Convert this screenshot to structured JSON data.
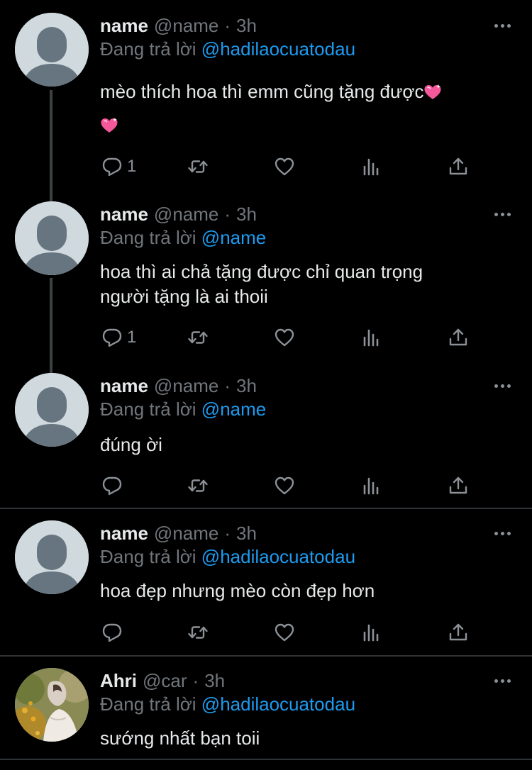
{
  "tweets": [
    {
      "name": "name",
      "handle": "@name",
      "dot": "·",
      "time": "3h",
      "reply_prefix": "Đang trả lời",
      "reply_to": "@hadilaocuatodau",
      "text_line1": "mèo thích hoa thì emm cũng tặng được",
      "reply_count": "1",
      "avatar_icon": "default-avatar-icon"
    },
    {
      "name": "name",
      "handle": "@name",
      "dot": "·",
      "time": "3h",
      "reply_prefix": "Đang trả lời",
      "reply_to": "@name",
      "text_line1": "hoa thì ai chả tặng được chỉ quan trọng",
      "text_line2": "người tặng là ai thoii",
      "reply_count": "1",
      "avatar_icon": "default-avatar-icon"
    },
    {
      "name": "name",
      "handle": "@name",
      "dot": "·",
      "time": "3h",
      "reply_prefix": "Đang trả lời",
      "reply_to": "@name",
      "text_line1": "đúng ời",
      "reply_count": "",
      "avatar_icon": "default-avatar-icon"
    },
    {
      "name": "name",
      "handle": "@name",
      "dot": "·",
      "time": "3h",
      "reply_prefix": "Đang trả lời",
      "reply_to": "@hadilaocuatodau",
      "text_line1": "hoa đẹp nhưng mèo còn đẹp hơn",
      "reply_count": "",
      "avatar_icon": "default-avatar-icon"
    },
    {
      "name": "Ahri",
      "handle": "@car",
      "dot": "·",
      "time": "3h",
      "reply_prefix": "Đang trả lời",
      "reply_to": "@hadilaocuatodau",
      "text_line1": "sướng nhất bạn toii",
      "avatar_icon": "photo-avatar"
    }
  ],
  "icons": {
    "reply": "reply-icon",
    "retweet": "retweet-icon",
    "like": "heart-icon",
    "views": "analytics-icon",
    "share": "share-icon",
    "more": "more-dots-icon",
    "emoji": "sparkling-heart-emoji"
  },
  "colors": {
    "background": "#000000",
    "text": "#e7e9ea",
    "secondary": "#71767b",
    "accent": "#1d9bf0",
    "divider": "#2f3336",
    "heart_emoji": "#f4589a"
  }
}
